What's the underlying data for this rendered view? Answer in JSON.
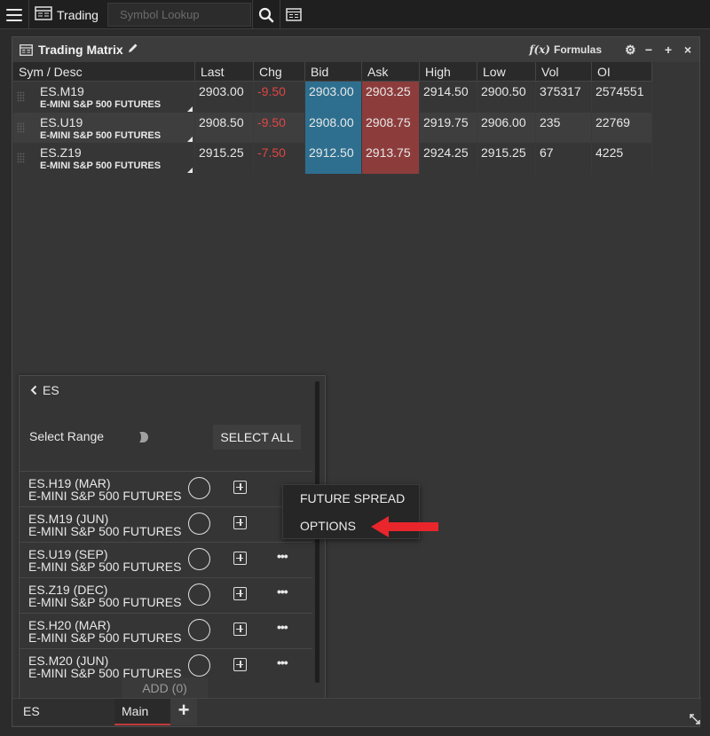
{
  "topbar": {
    "workspace_label": "Trading",
    "search_placeholder": "Symbol Lookup"
  },
  "window": {
    "title": "Trading Matrix",
    "formulas_label": "Formulas",
    "formulas_icon_text": "f(x)"
  },
  "grid": {
    "columns": [
      "Sym / Desc",
      "Last",
      "Chg",
      "Bid",
      "Ask",
      "High",
      "Low",
      "Vol",
      "OI"
    ],
    "rows": [
      {
        "sym": "ES.M19",
        "desc": "E-MINI S&P 500 FUTURES",
        "last": "2903.00",
        "chg": "-9.50",
        "bid": "2903.00",
        "ask": "2903.25",
        "high": "2914.50",
        "low": "2900.50",
        "vol": "375317",
        "oi": "2574551"
      },
      {
        "sym": "ES.U19",
        "desc": "E-MINI S&P 500 FUTURES",
        "last": "2908.50",
        "chg": "-9.50",
        "bid": "2908.00",
        "ask": "2908.75",
        "high": "2919.75",
        "low": "2906.00",
        "vol": "235",
        "oi": "22769"
      },
      {
        "sym": "ES.Z19",
        "desc": "E-MINI S&P 500 FUTURES",
        "last": "2915.25",
        "chg": "-7.50",
        "bid": "2912.50",
        "ask": "2913.75",
        "high": "2924.25",
        "low": "2915.25",
        "vol": "67",
        "oi": "4225"
      }
    ]
  },
  "panel": {
    "back_label": "ES",
    "select_range_label": "Select Range",
    "select_all_label": "SELECT ALL",
    "items": [
      {
        "name": "ES.H19 (MAR)",
        "desc": "E-MINI S&P 500 FUTURES"
      },
      {
        "name": "ES.M19 (JUN)",
        "desc": "E-MINI S&P 500 FUTURES"
      },
      {
        "name": "ES.U19 (SEP)",
        "desc": "E-MINI S&P 500 FUTURES"
      },
      {
        "name": "ES.Z19 (DEC)",
        "desc": "E-MINI S&P 500 FUTURES"
      },
      {
        "name": "ES.H20 (MAR)",
        "desc": "E-MINI S&P 500 FUTURES"
      },
      {
        "name": "ES.M20 (JUN)",
        "desc": "E-MINI S&P 500 FUTURES"
      }
    ],
    "more_label": "•••",
    "add_label": "ADD (0)"
  },
  "context_menu": {
    "items": [
      "FUTURE SPREAD",
      "OPTIONS"
    ]
  },
  "tabs": {
    "items": [
      "ES",
      "Main"
    ],
    "add_label": "+"
  },
  "colors": {
    "bid": "#2e6f8f",
    "ask": "#8d3c3c",
    "negative": "#e04545",
    "annotation_arrow": "#e8262b"
  }
}
